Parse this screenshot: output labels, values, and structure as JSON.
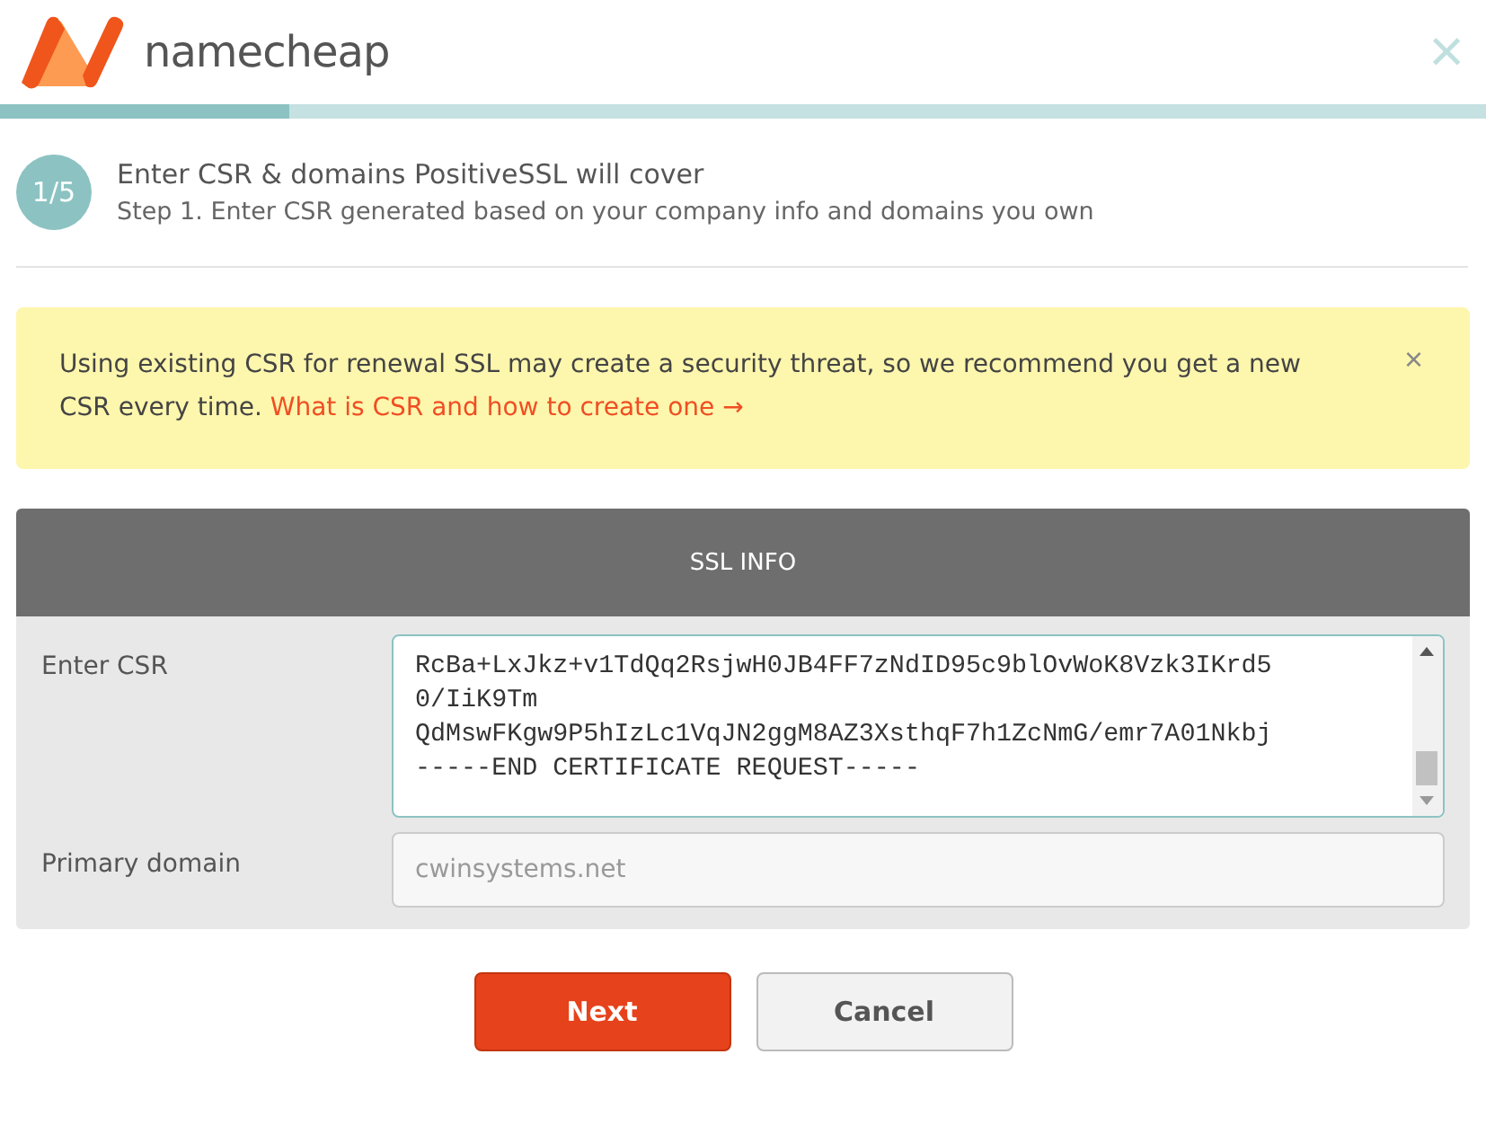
{
  "header": {
    "logo_text": "namecheap",
    "close": "×"
  },
  "progress": {
    "level": 0.195
  },
  "step": {
    "badge": "1/5",
    "title": "Enter CSR & domains PositiveSSL will cover",
    "subtitle": "Step 1. Enter CSR generated based on your company info and domains you own"
  },
  "alert": {
    "text": "Using existing CSR for renewal SSL may create a security threat, so we recommend you get a new CSR every time.",
    "link": "What is CSR and how to create one →",
    "close": "×"
  },
  "panel": {
    "title": "SSL INFO",
    "fields": [
      {
        "kind": "textarea",
        "label": "Enter CSR",
        "lines": [
          "RcBa+LxJkz+v1TdQq2RsjwH0JB4FF7zNdID95c9blOvWoK8Vzk3IKrd5",
          "0/IiK9Tm",
          "QdMswFKgw9P5hIzLc1VqJN2ggM8AZ3XsthqF7h1ZcNmG/emr7A01Nkbj",
          "-----END CERTIFICATE REQUEST-----"
        ]
      },
      {
        "kind": "input",
        "label": "Primary domain",
        "placeholder": "cwinsystems.net"
      }
    ]
  },
  "buttons": [
    {
      "kind": "primary",
      "label": "Next"
    },
    {
      "kind": "secondary",
      "label": "Cancel"
    }
  ]
}
